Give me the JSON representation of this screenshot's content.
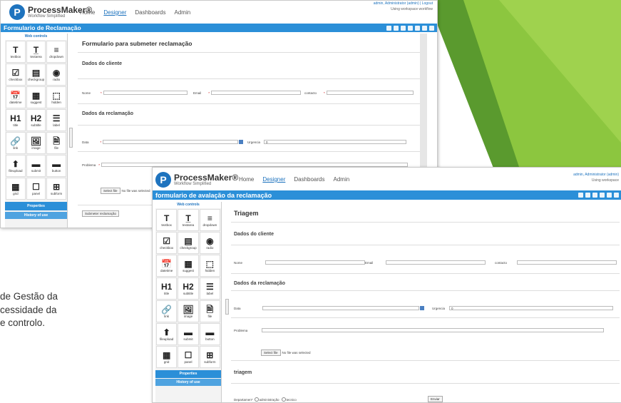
{
  "slide_text": {
    "line1": "de Gestão da",
    "line2": "cessidade da",
    "line3": "e controlo."
  },
  "back_window": {
    "logo_name": "ProcessMaker®",
    "logo_sub": "Workflow Simplified",
    "nav": [
      "Home",
      "Designer",
      "Dashboards",
      "Admin"
    ],
    "active_nav": "Designer",
    "user": "admin, Administrator (admin) | Logout",
    "workspace": "Using workspace workflow",
    "title": "Formulario de Reclamação",
    "palette_header": "Web controls",
    "controls": [
      {
        "icon": "T",
        "label": "textbox"
      },
      {
        "icon": "T̲",
        "label": "textarea"
      },
      {
        "icon": "≡",
        "label": "dropdown"
      },
      {
        "icon": "☑",
        "label": "checkbox"
      },
      {
        "icon": "▤",
        "label": "checkgroup"
      },
      {
        "icon": "◉",
        "label": "radio"
      },
      {
        "icon": "📅",
        "label": "datetime"
      },
      {
        "icon": "▦",
        "label": "suggest"
      },
      {
        "icon": "⬚",
        "label": "hidden"
      },
      {
        "icon": "H1",
        "label": "title"
      },
      {
        "icon": "H2",
        "label": "subtitle"
      },
      {
        "icon": "☰",
        "label": "label"
      },
      {
        "icon": "🔗",
        "label": "link"
      },
      {
        "icon": "🖼",
        "label": "image"
      },
      {
        "icon": "🗎",
        "label": "file"
      },
      {
        "icon": "⬆",
        "label": "fileupload"
      },
      {
        "icon": "▬",
        "label": "submit"
      },
      {
        "icon": "▬",
        "label": "button"
      },
      {
        "icon": "▦",
        "label": "grid"
      },
      {
        "icon": "☐",
        "label": "panel"
      },
      {
        "icon": "⊞",
        "label": "subform"
      }
    ],
    "properties": "Properties",
    "history": "History of use",
    "form_title": "Formulario para submeter reclamação",
    "section1": "Dados do cliente",
    "nome_label": "Nome",
    "email_label": "Email",
    "contacto_label": "contacto",
    "section2": "Dados da reclamação",
    "data_label": "Data",
    "urgencia_label": "Urgencia",
    "urgencia_value": "0",
    "problema_label": "Problema",
    "select_file": "Select file",
    "no_file": "No file was selected",
    "submit_label": "Submeter reclamação"
  },
  "front_window": {
    "logo_name": "ProcessMaker®",
    "logo_sub": "Workflow Simplified",
    "nav": [
      "Home",
      "Designer",
      "Dashboards",
      "Admin"
    ],
    "active_nav": "Designer",
    "user": "admin, Administrator (admin)",
    "workspace": "Using workspace",
    "title": "formulario de avalação da reclamação",
    "palette_header": "Web controls",
    "properties": "Properties",
    "history": "History of use",
    "form_title": "Triagem",
    "section1": "Dados do cliente",
    "nome_label": "Nome",
    "email_label": "Email",
    "contacto_label": "contacto",
    "section2": "Dados da reclamação",
    "data_label": "Data",
    "urgencia_label": "Urgencia",
    "urgencia_value": "0",
    "problema_label": "Problema",
    "select_file": "Select file",
    "no_file": "No file was selected",
    "section3": "triagem",
    "departamento_label": "Departamen*",
    "radio1": "administração",
    "radio2": "tecnico",
    "enviar_label": "Enviar"
  },
  "colors": {
    "accent": "#2b8fd8",
    "green_dark": "#4e8a2a",
    "green_light": "#8cc63f"
  }
}
